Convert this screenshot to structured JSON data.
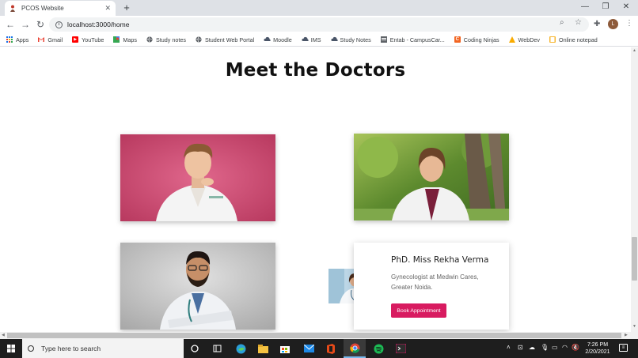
{
  "browser": {
    "tab_title": "PCOS Website",
    "url": "localhost:3000/home",
    "profile_initial": "L"
  },
  "bookmarks": [
    {
      "label": "Apps",
      "icon": "apps-grid-icon"
    },
    {
      "label": "Gmail",
      "icon": "gmail-icon"
    },
    {
      "label": "YouTube",
      "icon": "youtube-icon"
    },
    {
      "label": "Maps",
      "icon": "maps-icon"
    },
    {
      "label": "Study notes",
      "icon": "globe-icon"
    },
    {
      "label": "Student Web Portal",
      "icon": "globe-icon"
    },
    {
      "label": "Moodle",
      "icon": "cloud-icon"
    },
    {
      "label": "IMS",
      "icon": "cloud-icon"
    },
    {
      "label": "Study Notes",
      "icon": "cloud-icon"
    },
    {
      "label": "Entab - CampusCar...",
      "icon": "entab-icon"
    },
    {
      "label": "Coding Ninjas",
      "icon": "coding-ninjas-icon"
    },
    {
      "label": "WebDev",
      "icon": "webdev-icon"
    },
    {
      "label": "Online notepad",
      "icon": "notepad-icon"
    }
  ],
  "page": {
    "heading": "Meet the Doctors",
    "card": {
      "name": "PhD. Miss Rekha Verma",
      "description": "Gynecologist at Medwin Cares, Greater Noida.",
      "button_label": "Book Appointment"
    }
  },
  "taskbar": {
    "search_placeholder": "Type here to search",
    "time": "7:26 PM",
    "date": "2/20/2021"
  },
  "colors": {
    "accent": "#d81b60",
    "taskbar": "#1e1e1e"
  }
}
